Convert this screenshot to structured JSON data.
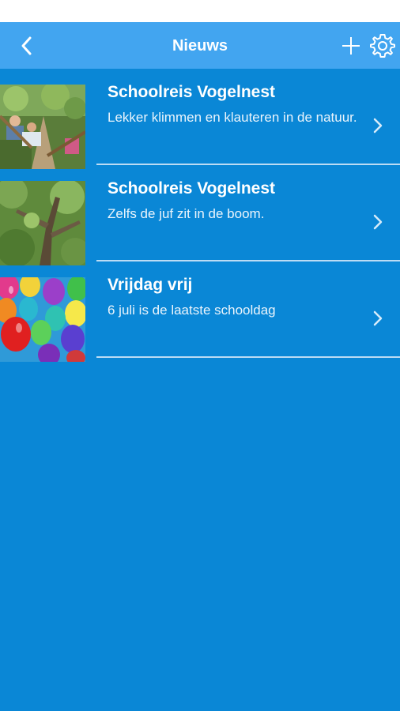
{
  "header": {
    "title": "Nieuws",
    "back_icon": "chevron-left-icon",
    "add_icon": "plus-icon",
    "settings_icon": "gear-icon"
  },
  "news": {
    "items": [
      {
        "title": "Schoolreis Vogelnest",
        "subtitle": "Lekker klimmen en klauteren in de natuur.",
        "thumbnail": "children-climbing-photo"
      },
      {
        "title": "Schoolreis Vogelnest",
        "subtitle": "Zelfs de juf zit in de boom.",
        "thumbnail": "tree-photo"
      },
      {
        "title": "Vrijdag vrij",
        "subtitle": "6 juli is de laatste schooldag",
        "thumbnail": "balloons-photo"
      }
    ]
  },
  "colors": {
    "background": "#0a87d6",
    "nav_bar": "#42a5f0",
    "divider": "#bcdcf4",
    "text": "#ffffff"
  }
}
